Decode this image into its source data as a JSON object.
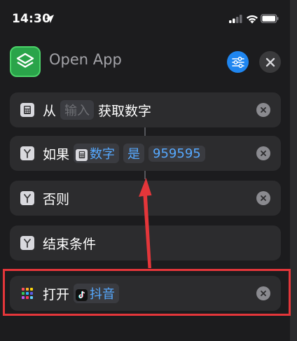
{
  "status_bar": {
    "time": "14:30"
  },
  "header": {
    "title": "Open App"
  },
  "actions": [
    {
      "prefix": "从",
      "token": "输入",
      "suffix": "获取数字",
      "icon": "calculator-icon"
    },
    {
      "prefix": "如果",
      "token_icon": "calculator-icon",
      "token": "数字",
      "operator": "是",
      "value": "959595",
      "icon": "branch-icon"
    },
    {
      "label": "否则",
      "icon": "branch-icon"
    },
    {
      "label": "结束条件",
      "icon": "branch-icon"
    },
    {
      "prefix": "打开",
      "app": "抖音",
      "icon": "apps-grid-icon",
      "app_icon": "tiktok-icon"
    }
  ],
  "colors": {
    "accent": "#1f86f0",
    "highlight": "#e4363a",
    "link": "#56a9ff"
  }
}
